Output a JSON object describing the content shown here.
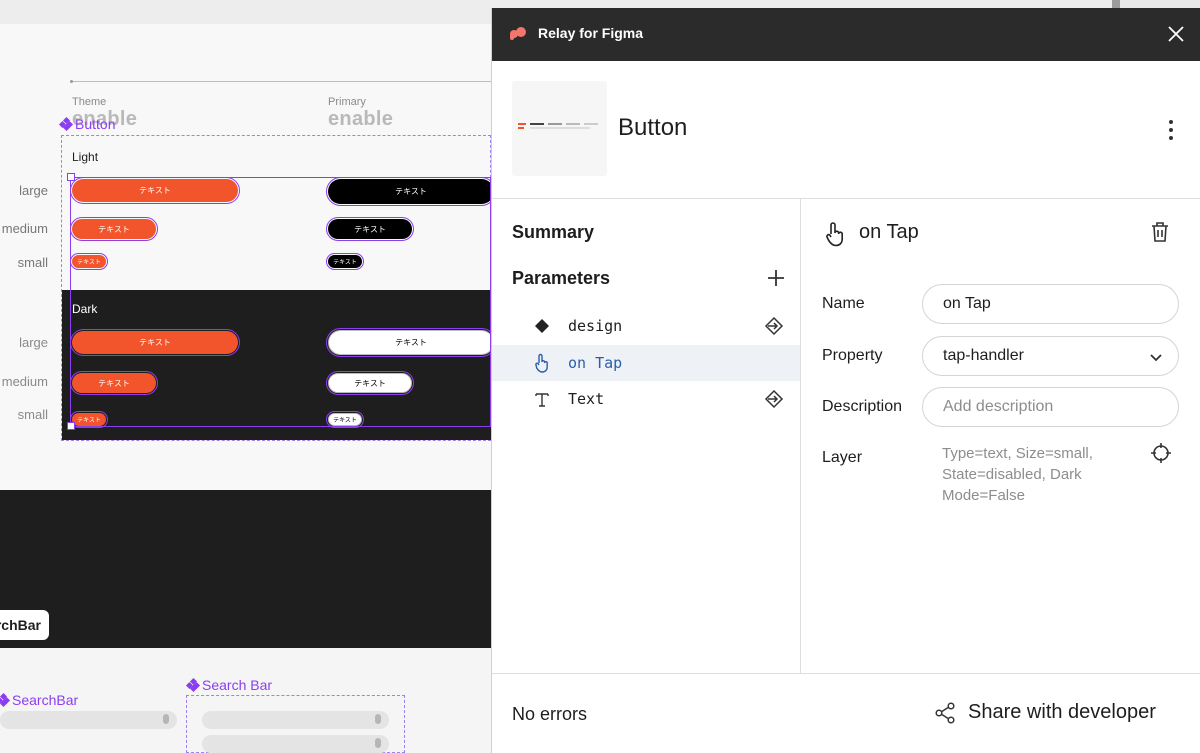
{
  "canvas": {
    "col_theme_label": "Theme",
    "col_theme_value": "enable",
    "col_primary_label": "Primary",
    "col_primary_value": "enable",
    "component_label": "Button",
    "group_light": "Light",
    "group_dark": "Dark",
    "rows": [
      "large",
      "medium",
      "small"
    ],
    "button_text": "テキスト",
    "searchbar_chip": "rchBar",
    "searchbar_label_left": "SearchBar",
    "searchbar_label_right": "Search Bar"
  },
  "panel": {
    "title": "Relay for Figma",
    "component_name": "Button",
    "sections": {
      "summary": "Summary",
      "parameters": "Parameters"
    },
    "parameters": [
      {
        "name": "design",
        "icon": "diamond-icon",
        "active": false
      },
      {
        "name": "on Tap",
        "icon": "tap-icon",
        "active": true
      },
      {
        "name": "Text",
        "icon": "text-t-icon",
        "active": false
      }
    ],
    "detail": {
      "title": "on Tap",
      "name_label": "Name",
      "name_value": "on Tap",
      "property_label": "Property",
      "property_value": "tap-handler",
      "description_label": "Description",
      "description_placeholder": "Add description",
      "layer_label": "Layer",
      "layer_value": "Type=text, Size=small, State=disabled, Dark Mode=False"
    },
    "footer": {
      "status": "No errors",
      "share_label": "Share with developer"
    }
  },
  "colors": {
    "accent_purple": "#8b3ef0",
    "button_orange": "#f2552c",
    "header_dark": "#2b2b2b",
    "logo_coral": "#f2766b"
  }
}
